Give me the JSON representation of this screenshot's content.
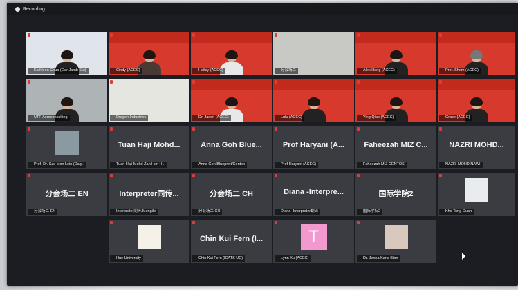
{
  "topbar": {
    "recording_label": "Recording"
  },
  "tiles": [
    {
      "caption": "Kathleen Chua (Gar Jamb Stu)"
    },
    {
      "caption": "Cindy (ACEC)"
    },
    {
      "caption": "Hailey (ACEC)"
    },
    {
      "caption": "分会场二"
    },
    {
      "caption": "Alex Hang (ACEC)"
    },
    {
      "caption": "Prof. Shem (ACEC)"
    },
    {
      "caption": "UTP Aeroconsulting"
    },
    {
      "caption": "Dragon Industries"
    },
    {
      "caption": "Dr. Jason (ACEC)"
    },
    {
      "caption": "Lulu (ACEC)"
    },
    {
      "caption": "Ying Qiao (ACEC)"
    },
    {
      "caption": "Grace (ACEC)"
    },
    {
      "caption": "Prof. Dr. Sze Mon Lein (Dag..."
    },
    {
      "big": "Tuan Haji Mohd...",
      "caption": "Tuan Haji Mohd Zahil bin H..."
    },
    {
      "big": "Anna Goh Blue...",
      "caption": "Anna Goh Blueprint/Centex"
    },
    {
      "big": "Prof Haryani (A...",
      "caption": "Prof Haryani (ACEC)"
    },
    {
      "big": "Faheezah MIZ C...",
      "caption": "Faheezah MIZ CENTOS"
    },
    {
      "big": "NAZRI MOHD...",
      "caption": "NAZRI MOHD NAWI"
    },
    {
      "big": "分会场二 EN",
      "caption": "分会场二 EN"
    },
    {
      "big": "Interpreter同传...",
      "caption": "Interpreter同传/Mengile"
    },
    {
      "big": "分会场二 CH",
      "caption": "分会场二 CH"
    },
    {
      "big": "Diana -Interpre...",
      "caption": "Diana -Interpreter翻译"
    },
    {
      "big": "国际学院2",
      "caption": "国际学院2"
    },
    {
      "caption": "Kho Tong Guan"
    },
    {
      "caption": "Hue University"
    },
    {
      "big": "Chin Kui Fern (I...",
      "caption": "Chin Kui Fern (ICATS UC)"
    },
    {
      "avatar": "T",
      "caption": "Lynn Xu (ACEC)"
    },
    {
      "caption": "Dr. Jenna Karla Bion"
    }
  ]
}
